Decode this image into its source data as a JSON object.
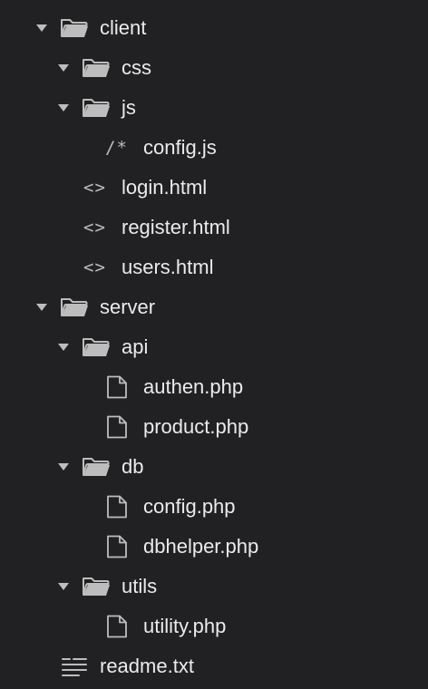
{
  "tree": {
    "client": {
      "label": "client",
      "css": {
        "label": "css"
      },
      "js": {
        "label": "js",
        "config_js": {
          "label": "config.js",
          "glyph": "/*"
        }
      },
      "login": {
        "label": "login.html",
        "glyph": "<>"
      },
      "register": {
        "label": "register.html",
        "glyph": "<>"
      },
      "users": {
        "label": "users.html",
        "glyph": "<>"
      }
    },
    "server": {
      "label": "server",
      "api": {
        "label": "api",
        "authen": {
          "label": "authen.php"
        },
        "product": {
          "label": "product.php"
        }
      },
      "db": {
        "label": "db",
        "config_php": {
          "label": "config.php"
        },
        "dbhelper": {
          "label": "dbhelper.php"
        }
      },
      "utils": {
        "label": "utils",
        "utility": {
          "label": "utility.php"
        }
      }
    },
    "readme": {
      "label": "readme.txt"
    }
  },
  "icons": {
    "folder_open": "folder-open-icon",
    "file": "file-icon",
    "code": "code-icon",
    "comment": "comment-icon",
    "text": "text-file-icon",
    "chevron": "chevron-down-icon"
  },
  "colors": {
    "background": "#212123",
    "text": "#ebebeb",
    "icon": "#bdbdbd"
  }
}
